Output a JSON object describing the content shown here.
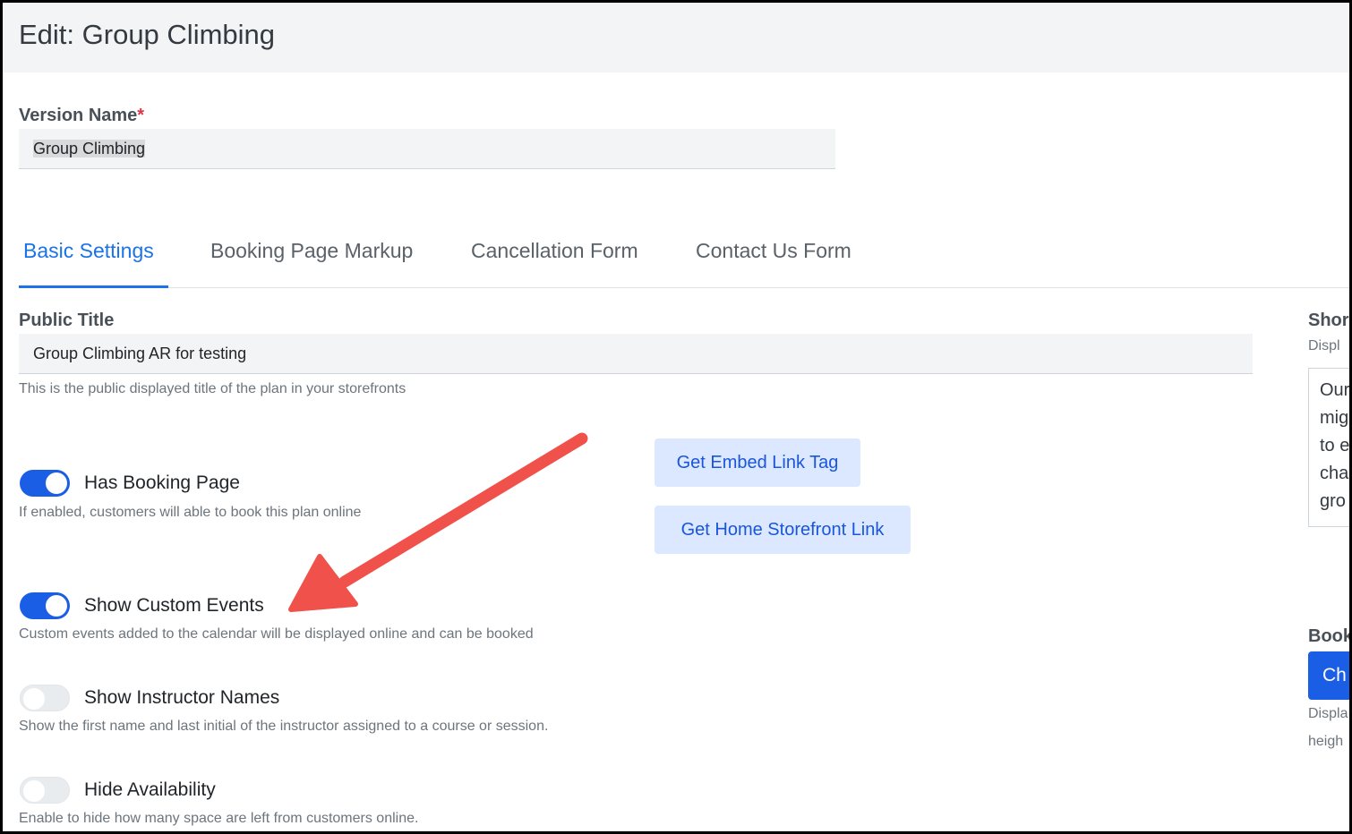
{
  "header": {
    "title": "Edit: Group Climbing"
  },
  "version_name": {
    "label": "Version Name",
    "required_mark": "*",
    "value": "Group Climbing"
  },
  "tabs": [
    {
      "label": "Basic Settings",
      "active": true
    },
    {
      "label": "Booking Page Markup",
      "active": false
    },
    {
      "label": "Cancellation Form",
      "active": false
    },
    {
      "label": "Contact Us Form",
      "active": false
    }
  ],
  "public_title": {
    "label": "Public Title",
    "value": "Group Climbing AR for testing",
    "help": "This is the public displayed title of the plan in your storefronts"
  },
  "toggles": [
    {
      "label": "Has Booking Page",
      "on": true,
      "help": "If enabled, customers will able to book this plan online"
    },
    {
      "label": "Show Custom Events",
      "on": true,
      "help": "Custom events added to the calendar will be displayed online and can be booked"
    },
    {
      "label": "Show Instructor Names",
      "on": false,
      "help": "Show the first name and last initial of the instructor assigned to a course or session."
    },
    {
      "label": "Hide Availability",
      "on": false,
      "help": "Enable to hide how many space are left from customers online."
    }
  ],
  "buttons": {
    "embed_link": "Get Embed Link Tag",
    "home_storefront": "Get Home Storefront Link"
  },
  "right_column": {
    "heading_1": "Shor",
    "sub_1": "Displ",
    "box_lines": [
      "Our",
      "mig",
      "to e",
      "cha",
      "gro"
    ],
    "heading_2": "Book",
    "button": "Ch",
    "sub_2a": "Displa",
    "sub_2b": "heigh"
  },
  "colors": {
    "accent": "#1a73e8",
    "toggle_on": "#1b5ee6",
    "arrow": "#f0514a"
  }
}
